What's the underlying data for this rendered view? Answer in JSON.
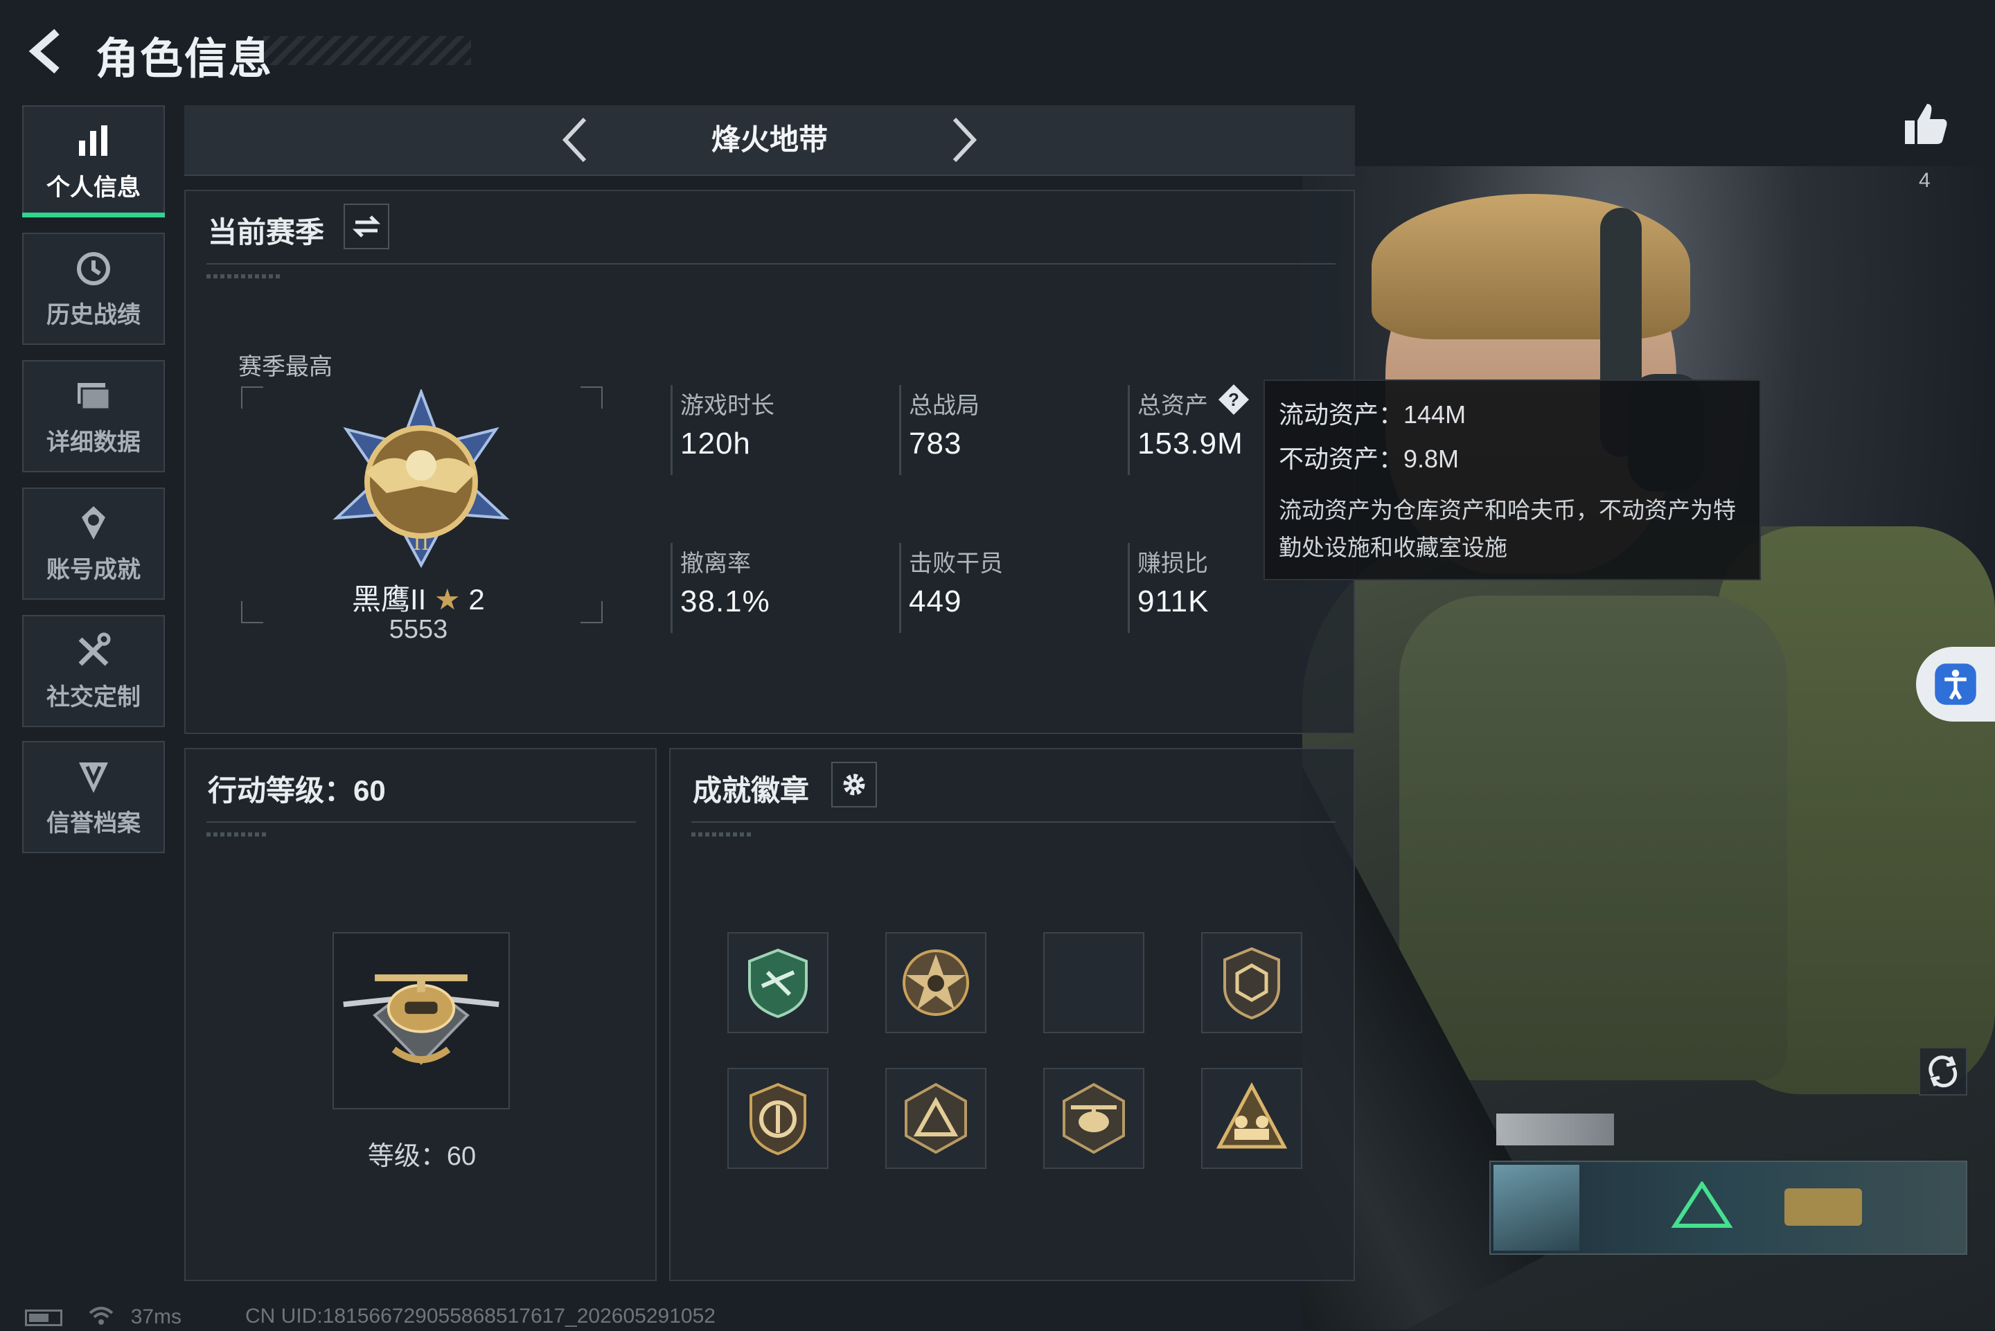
{
  "header": {
    "title": "角色信息"
  },
  "sidebar": {
    "items": [
      {
        "label": "个人信息",
        "icon": "bar-chart-icon",
        "active": true
      },
      {
        "label": "历史战绩",
        "icon": "history-clock-icon",
        "active": false
      },
      {
        "label": "详细数据",
        "icon": "folder-icon",
        "active": false
      },
      {
        "label": "账号成就",
        "icon": "achievement-icon",
        "active": false
      },
      {
        "label": "社交定制",
        "icon": "tools-icon",
        "active": false
      },
      {
        "label": "信誉档案",
        "icon": "shield-v-icon",
        "active": false
      }
    ]
  },
  "mode_selector": {
    "current": "烽火地带"
  },
  "season": {
    "title": "当前赛季",
    "best_label": "赛季最高",
    "rank_name": "黑鹰II",
    "rank_stars": "2",
    "rank_points": "5553",
    "stats": [
      {
        "label": "游戏时长",
        "value": "120h"
      },
      {
        "label": "总战局",
        "value": "783"
      },
      {
        "label": "总资产",
        "value": "153.9M"
      },
      {
        "label": "撤离率",
        "value": "38.1%"
      },
      {
        "label": "击败干员",
        "value": "449"
      },
      {
        "label": "赚损比",
        "value": "911K"
      }
    ]
  },
  "tooltip": {
    "line1": "流动资产：144M",
    "line2": "不动资产：9.8M",
    "desc": "流动资产为仓库资产和哈夫币，不动资产为特勤处设施和收藏室设施"
  },
  "level": {
    "title": "行动等级：60",
    "caption": "等级：60"
  },
  "badges": {
    "title": "成就徽章",
    "items": [
      "green-shield-badge-icon",
      "star-skull-badge-icon",
      "empty-slot",
      "hex-crest-badge-icon",
      "round-shield-badge-icon",
      "triangle-badge-icon",
      "helicopter-badge-icon",
      "squad-badge-icon"
    ]
  },
  "social": {
    "like_count": "4"
  },
  "footer": {
    "ping": "37ms",
    "uid": "CN UID:1815667290558685176​17_202605291052"
  },
  "colors": {
    "accent_green": "#31d48c",
    "background": "#1b2027",
    "panel": "#20262d",
    "gold": "#c9a25a"
  }
}
